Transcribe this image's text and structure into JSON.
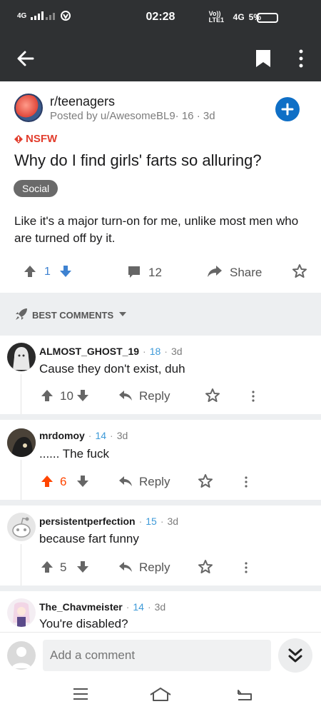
{
  "status_bar": {
    "network_left": "4G",
    "time": "02:28",
    "volte": "Vo)) LTE1",
    "network_right": "4G",
    "battery": "5%"
  },
  "post": {
    "subreddit": "r/teenagers",
    "posted_by": "Posted by u/AwesomeBL9",
    "author_karma": "16",
    "age": "3d",
    "nsfw_label": "NSFW",
    "title": "Why do I find girls' farts so alluring?",
    "flair": "Social",
    "body": "Like it's a major turn-on for me, unlike most men who are turned off by it.",
    "score": "1",
    "comment_count": "12",
    "share_label": "Share"
  },
  "sort": {
    "label": "BEST COMMENTS"
  },
  "comments": [
    {
      "author": "ALMOST_GHOST_19",
      "karma": "18",
      "age": "3d",
      "body": "Cause they don't exist, duh",
      "score": "10",
      "reply_label": "Reply",
      "upvoted": false
    },
    {
      "author": "mrdomoy",
      "karma": "14",
      "age": "3d",
      "body": "...... The fuck",
      "score": "6",
      "reply_label": "Reply",
      "upvoted": true
    },
    {
      "author": "persistentperfection",
      "karma": "15",
      "age": "3d",
      "body": "because fart funny",
      "score": "5",
      "reply_label": "Reply",
      "upvoted": false
    },
    {
      "author": "The_Chavmeister",
      "karma": "14",
      "age": "3d",
      "body": "You're disabled?"
    }
  ],
  "composer": {
    "placeholder": "Add a comment"
  },
  "colors": {
    "bar_dark": "#2f3133",
    "accent_blue": "#0f6fc6",
    "upvote_orange": "#ff4500",
    "nsfw_red": "#e23d2d",
    "karma_blue": "#3e9ad8"
  },
  "icons": [
    "back-arrow-icon",
    "bookmark-icon",
    "more-vertical-icon",
    "plus-icon",
    "upvote-icon",
    "downvote-icon",
    "comment-icon",
    "share-icon",
    "award-icon",
    "rocket-icon",
    "chevron-down-icon",
    "reply-icon",
    "double-chevron-down-icon",
    "menu-icon",
    "home-icon",
    "back-icon"
  ]
}
